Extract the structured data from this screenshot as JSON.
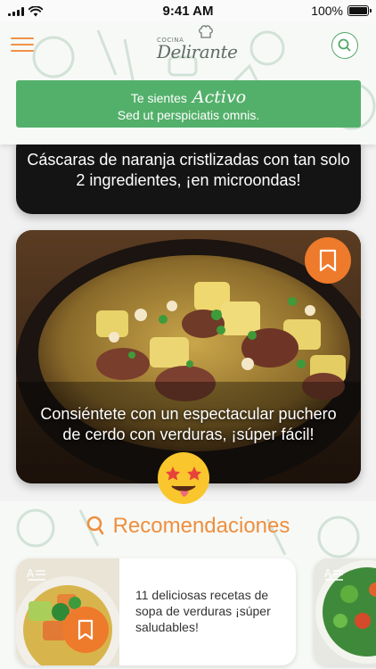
{
  "status_bar": {
    "time": "9:41 AM",
    "battery": "100%",
    "battery_level": 1.0
  },
  "header": {
    "logo_small": "COCINA",
    "logo_main": "Delirante",
    "mood_prefix": "Te sientes",
    "mood_value": "Activo",
    "mood_subtitle": "Sed ut perspiciatis omnis."
  },
  "feed": {
    "cards": [
      {
        "title": "Cáscaras de naranja cristlizadas con tan solo 2 ingredientes, ¡en microondas!"
      },
      {
        "title": "Consiéntete con un espectacular puchero de cerdo con verduras, ¡súper fácil!"
      }
    ]
  },
  "recommendations": {
    "title": "Recomendaciones",
    "items": [
      {
        "text": "11 deliciosas recetas de sopa de verduras ¡súper saludables!"
      }
    ]
  },
  "colors": {
    "brand_green": "#53b06a",
    "accent_orange": "#ee7a2c",
    "title_orange": "#ee8f3e"
  },
  "icons": [
    "menu-icon",
    "search-icon",
    "bookmark-icon",
    "magnifier-icon",
    "article-icon",
    "star-struck-emoji"
  ]
}
